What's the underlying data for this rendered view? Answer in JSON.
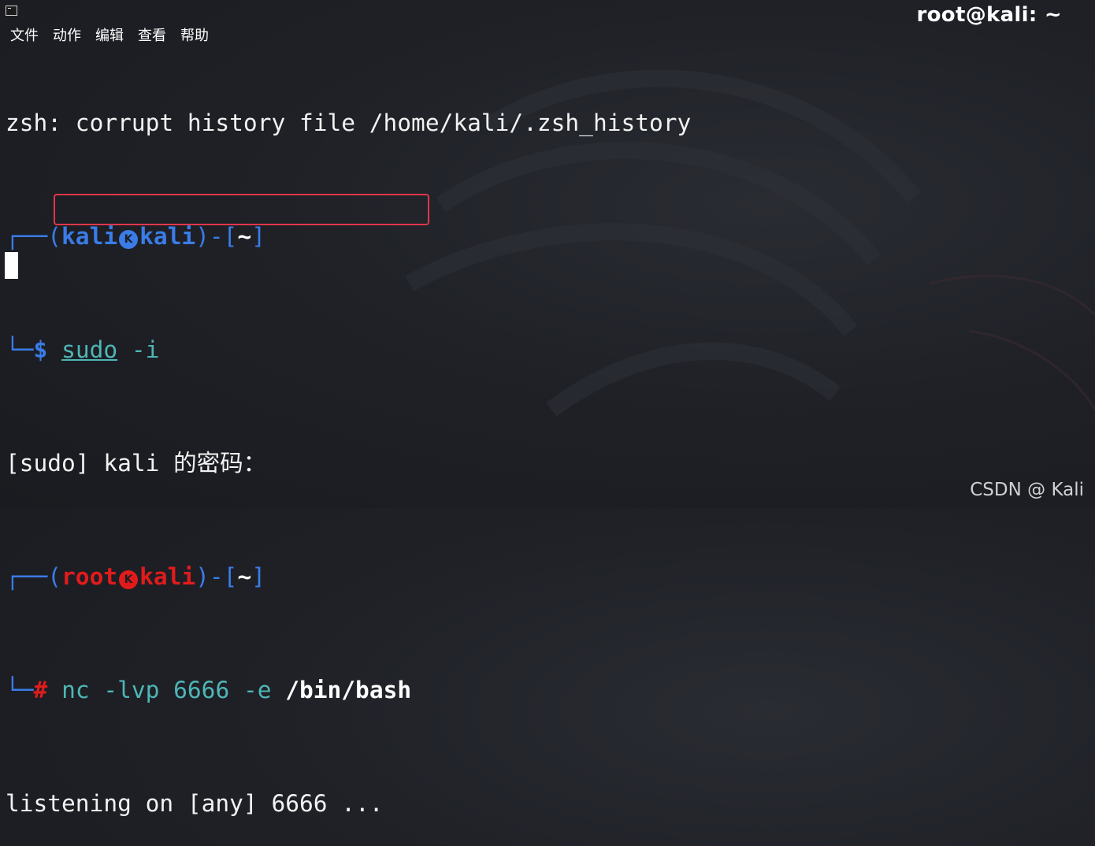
{
  "window": {
    "title": "root@kali: ~",
    "icon": "terminal-icon"
  },
  "menu": [
    "文件",
    "动作",
    "编辑",
    "查看",
    "帮助"
  ],
  "terminal": {
    "line1": "zsh: corrupt history file /home/kali/.zsh_history",
    "prompt1": {
      "corner_top": "┌──(",
      "user": "kali",
      "logo": "K",
      "host": "kali",
      "mid": ")-[",
      "dir": "~",
      "close": "]",
      "corner_bottom": "└─",
      "symbol": "$",
      "cmd": "sudo",
      "args": " -i"
    },
    "sudo_prompt": "[sudo] kali 的密码：",
    "prompt2": {
      "corner_top": "┌──(",
      "user": "root",
      "logo": "K",
      "host": "kali",
      "mid": ")-[",
      "dir": "~",
      "close": "]",
      "corner_bottom": "└─",
      "symbol": "#",
      "cmd": "nc",
      "args": " -lvp 6666 -e ",
      "path": "/bin/bash"
    },
    "output": "listening on [any] 6666 ..."
  },
  "watermark": "CSDN @ Kali",
  "colors": {
    "background": "#1f2127",
    "prompt_blue": "#3a7ce8",
    "prompt_red": "#e11b1b",
    "command_cyan": "#4fb6b6",
    "highlight_box": "#e0364a"
  }
}
